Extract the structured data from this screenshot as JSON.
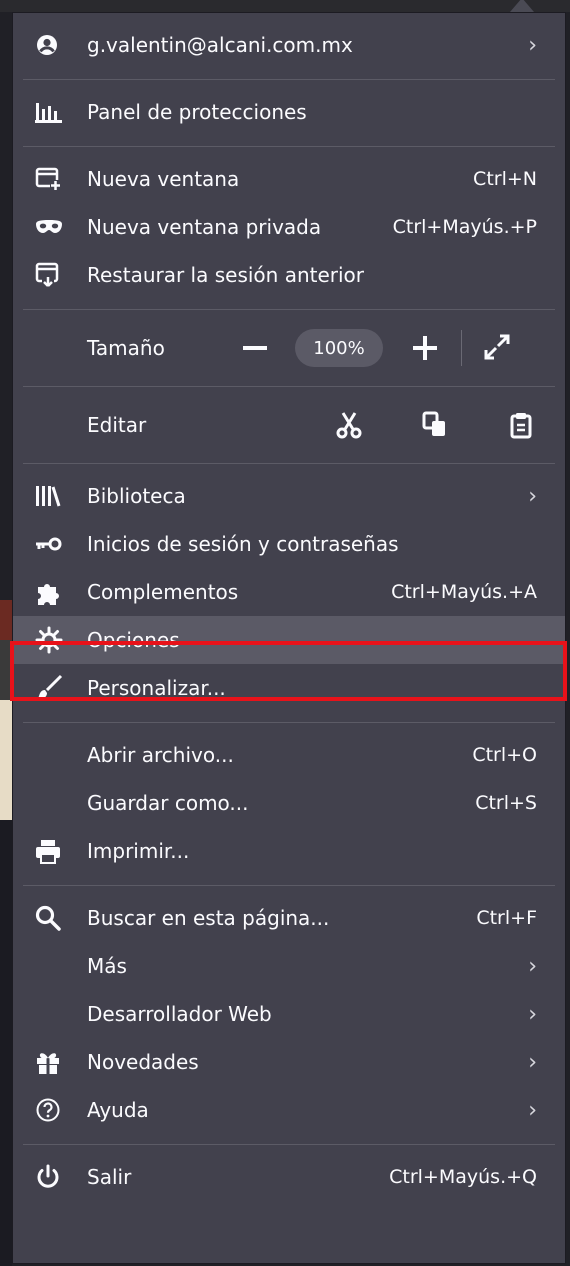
{
  "account": {
    "email": "g.valentin@alcani.com.mx"
  },
  "protections": {
    "label": "Panel de protecciones"
  },
  "windows": [
    {
      "label": "Nueva ventana",
      "shortcut": "Ctrl+N"
    },
    {
      "label": "Nueva ventana privada",
      "shortcut": "Ctrl+Mayús.+P"
    },
    {
      "label": "Restaurar la sesión anterior",
      "shortcut": ""
    }
  ],
  "zoom": {
    "label": "Tamaño",
    "value": "100%"
  },
  "edit": {
    "label": "Editar"
  },
  "library": [
    {
      "label": "Biblioteca",
      "shortcut": ""
    },
    {
      "label": "Inicios de sesión y contraseñas",
      "shortcut": ""
    },
    {
      "label": "Complementos",
      "shortcut": "Ctrl+Mayús.+A"
    },
    {
      "label": "Opciones",
      "shortcut": ""
    },
    {
      "label": "Personalizar...",
      "shortcut": ""
    }
  ],
  "file": [
    {
      "label": "Abrir archivo...",
      "shortcut": "Ctrl+O"
    },
    {
      "label": "Guardar como...",
      "shortcut": "Ctrl+S"
    },
    {
      "label": "Imprimir...",
      "shortcut": ""
    }
  ],
  "tools": [
    {
      "label": "Buscar en esta página...",
      "shortcut": "Ctrl+F"
    },
    {
      "label": "Más",
      "shortcut": ""
    },
    {
      "label": "Desarrollador Web",
      "shortcut": ""
    },
    {
      "label": "Novedades",
      "shortcut": ""
    },
    {
      "label": "Ayuda",
      "shortcut": ""
    }
  ],
  "quit": {
    "label": "Salir",
    "shortcut": "Ctrl+Mayús.+Q"
  },
  "colors": {
    "panel": "#42414d",
    "hover": "#5b5a66",
    "highlight": "#e8121a",
    "text": "#fbfbfe"
  }
}
